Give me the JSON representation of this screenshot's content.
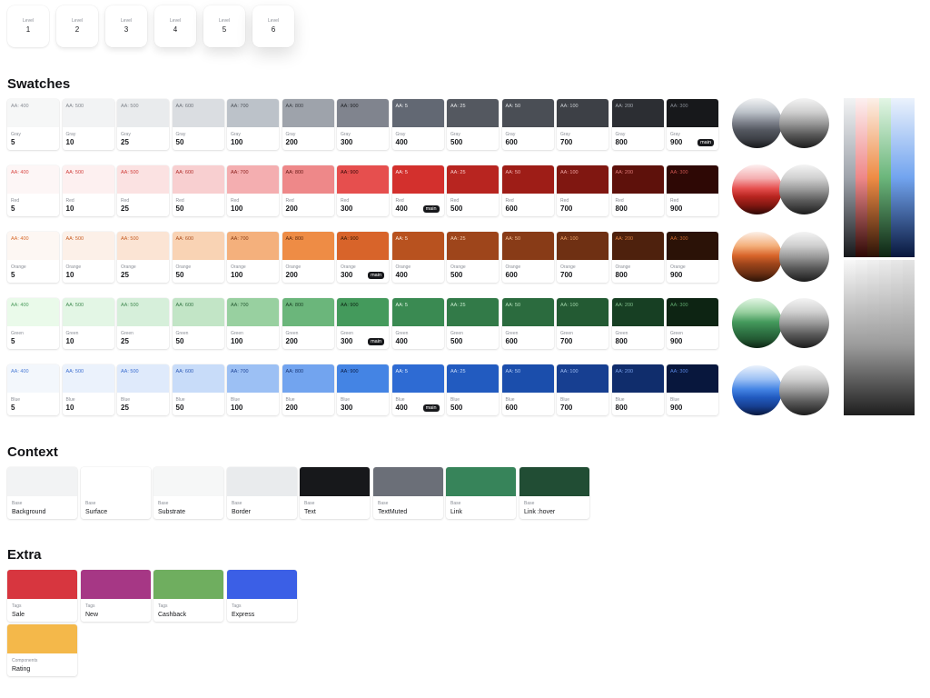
{
  "levels": [
    {
      "label": "Level",
      "value": "1"
    },
    {
      "label": "Level",
      "value": "2"
    },
    {
      "label": "Level",
      "value": "3"
    },
    {
      "label": "Level",
      "value": "4"
    },
    {
      "label": "Level",
      "value": "5"
    },
    {
      "label": "Level",
      "value": "6"
    }
  ],
  "swatches": {
    "title": "Swatches",
    "families": [
      {
        "name": "Gray",
        "main": "900",
        "shades": [
          {
            "level": "5",
            "aa": "AA: 400",
            "color": "#f6f7f7",
            "text": "#8a8e96"
          },
          {
            "level": "10",
            "aa": "AA: 500",
            "color": "#f2f3f4",
            "text": "#80858c"
          },
          {
            "level": "25",
            "aa": "AA: 500",
            "color": "#e9ebed",
            "text": "#80858c"
          },
          {
            "level": "50",
            "aa": "AA: 600",
            "color": "#dadde1",
            "text": "#6c7179"
          },
          {
            "level": "100",
            "aa": "AA: 700",
            "color": "#bcc2c9",
            "text": "#4f545b"
          },
          {
            "level": "200",
            "aa": "AA: 800",
            "color": "#9ea3ab",
            "text": "#3a3e44"
          },
          {
            "level": "300",
            "aa": "AA: 900",
            "color": "#80848e",
            "text": "#1f2226"
          },
          {
            "level": "400",
            "aa": "AA: 5",
            "color": "#626873",
            "text": "#f2f3f4"
          },
          {
            "level": "500",
            "aa": "AA: 25",
            "color": "#545860",
            "text": "#e6e8ea"
          },
          {
            "level": "600",
            "aa": "AA: 50",
            "color": "#4a4e55",
            "text": "#dde0e3"
          },
          {
            "level": "700",
            "aa": "AA: 100",
            "color": "#3d4046",
            "text": "#c9cdd2"
          },
          {
            "level": "800",
            "aa": "AA: 200",
            "color": "#2c2e33",
            "text": "#a7acb3"
          },
          {
            "level": "900",
            "aa": "AA: 300",
            "color": "#17181b",
            "text": "#868b93"
          }
        ]
      },
      {
        "name": "Red",
        "main": "400",
        "shades": [
          {
            "level": "5",
            "aa": "AA: 400",
            "color": "#fdf6f6",
            "text": "#d94a47"
          },
          {
            "level": "10",
            "aa": "AA: 500",
            "color": "#fdf0f0",
            "text": "#d03d3a"
          },
          {
            "level": "25",
            "aa": "AA: 500",
            "color": "#fbe2e2",
            "text": "#d03d3a"
          },
          {
            "level": "50",
            "aa": "AA: 600",
            "color": "#f8cfd0",
            "text": "#b22e2b"
          },
          {
            "level": "100",
            "aa": "AA: 700",
            "color": "#f4aeb0",
            "text": "#8a1f1c"
          },
          {
            "level": "200",
            "aa": "AA: 800",
            "color": "#ee8889",
            "text": "#641613"
          },
          {
            "level": "300",
            "aa": "AA: 900",
            "color": "#e64f4e",
            "text": "#3a0a08"
          },
          {
            "level": "400",
            "aa": "AA: 5",
            "color": "#d3302d",
            "text": "#fde8e8"
          },
          {
            "level": "500",
            "aa": "AA: 25",
            "color": "#b82520",
            "text": "#f7c9c8"
          },
          {
            "level": "600",
            "aa": "AA: 50",
            "color": "#9e1d17",
            "text": "#f2b3b2"
          },
          {
            "level": "700",
            "aa": "AA: 100",
            "color": "#801711",
            "text": "#eea1a0"
          },
          {
            "level": "800",
            "aa": "AA: 200",
            "color": "#5e110b",
            "text": "#e07b79"
          },
          {
            "level": "900",
            "aa": "AA: 300",
            "color": "#2e0805",
            "text": "#c9534f"
          }
        ]
      },
      {
        "name": "Orange",
        "main": "300",
        "shades": [
          {
            "level": "5",
            "aa": "AA: 400",
            "color": "#fdf7f3",
            "text": "#d86a2c"
          },
          {
            "level": "10",
            "aa": "AA: 500",
            "color": "#fcf0e8",
            "text": "#c75c22"
          },
          {
            "level": "25",
            "aa": "AA: 500",
            "color": "#fbe4d4",
            "text": "#c75c22"
          },
          {
            "level": "50",
            "aa": "AA: 600",
            "color": "#f9d3b4",
            "text": "#ad4d1c"
          },
          {
            "level": "100",
            "aa": "AA: 700",
            "color": "#f4b07c",
            "text": "#8a3c15"
          },
          {
            "level": "200",
            "aa": "AA: 800",
            "color": "#ee8c45",
            "text": "#5e290e"
          },
          {
            "level": "300",
            "aa": "AA: 900",
            "color": "#d8642a",
            "text": "#391805"
          },
          {
            "level": "400",
            "aa": "AA: 5",
            "color": "#b8521f",
            "text": "#fde9dc"
          },
          {
            "level": "500",
            "aa": "AA: 25",
            "color": "#9e451b",
            "text": "#f8cfb2"
          },
          {
            "level": "600",
            "aa": "AA: 50",
            "color": "#883b17",
            "text": "#f2b98e"
          },
          {
            "level": "700",
            "aa": "AA: 100",
            "color": "#6f3013",
            "text": "#ec9e64"
          },
          {
            "level": "800",
            "aa": "AA: 200",
            "color": "#4e210d",
            "text": "#de7f3f"
          },
          {
            "level": "900",
            "aa": "AA: 300",
            "color": "#2b1207",
            "text": "#c8632c"
          }
        ]
      },
      {
        "name": "Green",
        "main": "300",
        "shades": [
          {
            "level": "5",
            "aa": "AA: 400",
            "color": "#eafaea",
            "text": "#4e9c5e"
          },
          {
            "level": "10",
            "aa": "AA: 500",
            "color": "#e3f6e5",
            "text": "#418a51"
          },
          {
            "level": "25",
            "aa": "AA: 500",
            "color": "#d6efda",
            "text": "#418a51"
          },
          {
            "level": "50",
            "aa": "AA: 600",
            "color": "#c2e5c6",
            "text": "#337443"
          },
          {
            "level": "100",
            "aa": "AA: 700",
            "color": "#98d0a0",
            "text": "#265a33"
          },
          {
            "level": "200",
            "aa": "AA: 800",
            "color": "#6bb67b",
            "text": "#183e22"
          },
          {
            "level": "300",
            "aa": "AA: 900",
            "color": "#449a5c",
            "text": "#0c2413"
          },
          {
            "level": "400",
            "aa": "AA: 5",
            "color": "#3a8a52",
            "text": "#e1f5e4"
          },
          {
            "level": "500",
            "aa": "AA: 25",
            "color": "#327a48",
            "text": "#c8ebcd"
          },
          {
            "level": "600",
            "aa": "AA: 50",
            "color": "#2b6b3e",
            "text": "#b3e0ba"
          },
          {
            "level": "700",
            "aa": "AA: 100",
            "color": "#235a33",
            "text": "#9ed3a7"
          },
          {
            "level": "800",
            "aa": "AA: 200",
            "color": "#173f23",
            "text": "#7fbe8a"
          },
          {
            "level": "900",
            "aa": "AA: 300",
            "color": "#0d2413",
            "text": "#5da56b"
          }
        ]
      },
      {
        "name": "Blue",
        "main": "400",
        "shades": [
          {
            "level": "5",
            "aa": "AA: 400",
            "color": "#f3f7fc",
            "text": "#4f7fd6"
          },
          {
            "level": "10",
            "aa": "AA: 500",
            "color": "#ebf2fc",
            "text": "#3d6fd0"
          },
          {
            "level": "25",
            "aa": "AA: 500",
            "color": "#dfeafb",
            "text": "#3d6fd0"
          },
          {
            "level": "50",
            "aa": "AA: 600",
            "color": "#c8dcf9",
            "text": "#2e5bb8"
          },
          {
            "level": "100",
            "aa": "AA: 700",
            "color": "#9cc0f4",
            "text": "#22479a"
          },
          {
            "level": "200",
            "aa": "AA: 800",
            "color": "#72a4ef",
            "text": "#173575"
          },
          {
            "level": "300",
            "aa": "AA: 900",
            "color": "#4484e4",
            "text": "#0b1e48"
          },
          {
            "level": "400",
            "aa": "AA: 5",
            "color": "#2e6bd3",
            "text": "#e3edfc"
          },
          {
            "level": "500",
            "aa": "AA: 25",
            "color": "#225bc0",
            "text": "#c7daf8"
          },
          {
            "level": "600",
            "aa": "AA: 50",
            "color": "#1b4eac",
            "text": "#b3ccf5"
          },
          {
            "level": "700",
            "aa": "AA: 100",
            "color": "#173f91",
            "text": "#9ab9f1"
          },
          {
            "level": "800",
            "aa": "AA: 200",
            "color": "#102d6c",
            "text": "#779fea"
          },
          {
            "level": "900",
            "aa": "AA: 300",
            "color": "#08173d",
            "text": "#5683de"
          }
        ]
      }
    ],
    "main_label": "main"
  },
  "context": {
    "title": "Context",
    "tokens": [
      {
        "group": "Base",
        "name": "Background",
        "color": "#f2f3f4"
      },
      {
        "group": "Base",
        "name": "Surface",
        "color": "#ffffff"
      },
      {
        "group": "Base",
        "name": "Substrate",
        "color": "#f6f7f7"
      },
      {
        "group": "Base",
        "name": "Border",
        "color": "#e9ebed"
      },
      {
        "group": "Base",
        "name": "Text",
        "color": "#17181b"
      },
      {
        "group": "Base",
        "name": "TextMuted",
        "color": "#6b6f78"
      },
      {
        "group": "Base",
        "name": "Link",
        "color": "#37845a"
      },
      {
        "group": "Base",
        "name": "Link :hover",
        "color": "#214d34"
      }
    ]
  },
  "extra": {
    "title": "Extra",
    "tokens": [
      {
        "group": "Tags",
        "name": "Sale",
        "color": "#d7363f"
      },
      {
        "group": "Tags",
        "name": "New",
        "color": "#a63785"
      },
      {
        "group": "Tags",
        "name": "Cashback",
        "color": "#6fae5f"
      },
      {
        "group": "Tags",
        "name": "Express",
        "color": "#3b5fe6"
      },
      {
        "group": "Components",
        "name": "Rating",
        "color": "#f4b84a"
      }
    ]
  }
}
